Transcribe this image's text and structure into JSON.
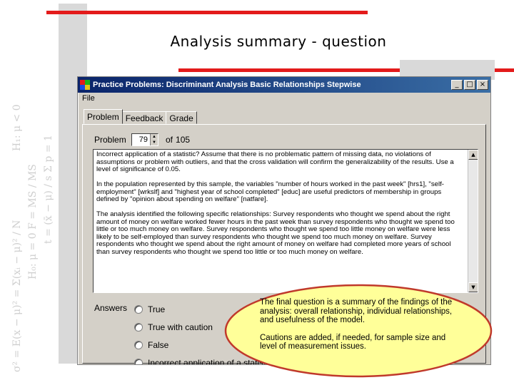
{
  "slide": {
    "title": "Analysis summary - question"
  },
  "colors": {
    "accent_red": "#e31b1b",
    "titlebar_blue": "#0a246a",
    "callout_fill": "#ffff99",
    "callout_border": "#c0392b"
  },
  "window": {
    "title": "Practice Problems: Discriminant Analysis  Basic Relationships  Stepwise",
    "controls": {
      "minimize": "_",
      "maximize": "□",
      "close": "×"
    },
    "menu": {
      "file": "File"
    },
    "tabs": [
      {
        "label": "Problem"
      },
      {
        "label": "Feedback"
      },
      {
        "label": "Grade"
      }
    ],
    "problem": {
      "label": "Problem",
      "value": "79",
      "of_label": "of",
      "total": "105"
    },
    "problem_text": [
      "Incorrect application of a statistic? Assume that there is no problematic pattern of missing data, no violations of assumptions or problem with outliers, and that the cross validation will confirm the generalizability of the results. Use a level of significance of 0.05.",
      "In the population represented by this sample, the variables \"number of hours worked in the past week\" [hrs1], \"self-employment\" [wrkslf] and \"highest year of school completed\" [educ] are useful predictors of membership in groups defined by \"opinion about spending on welfare\" [natfare].",
      "The analysis identified the following specific relationships: Survey respondents who thought we spend about the right amount of money on welfare worked fewer hours in the past week than survey respondents who thought we spend too little or too much money on welfare. Survey respondents who thought we spend too little money on welfare were less likely to be self-employed than survey respondents who thought we spend too much money on welfare. Survey respondents who thought we spend about the right amount of money on welfare had completed more years of school than survey respondents who thought we spend too little or too much money on welfare."
    ],
    "answers_label": "Answers",
    "answers": [
      {
        "label": "True"
      },
      {
        "label": "True with caution"
      },
      {
        "label": "False"
      },
      {
        "label": "Incorrect application of a statistic"
      }
    ]
  },
  "callout": {
    "paragraphs": [
      "The final question is a summary of the findings of the analysis: overall relationship, individual relationships, and usefulness of the model.",
      "Cautions are added, if needed, for sample size and level of measurement issues."
    ]
  }
}
